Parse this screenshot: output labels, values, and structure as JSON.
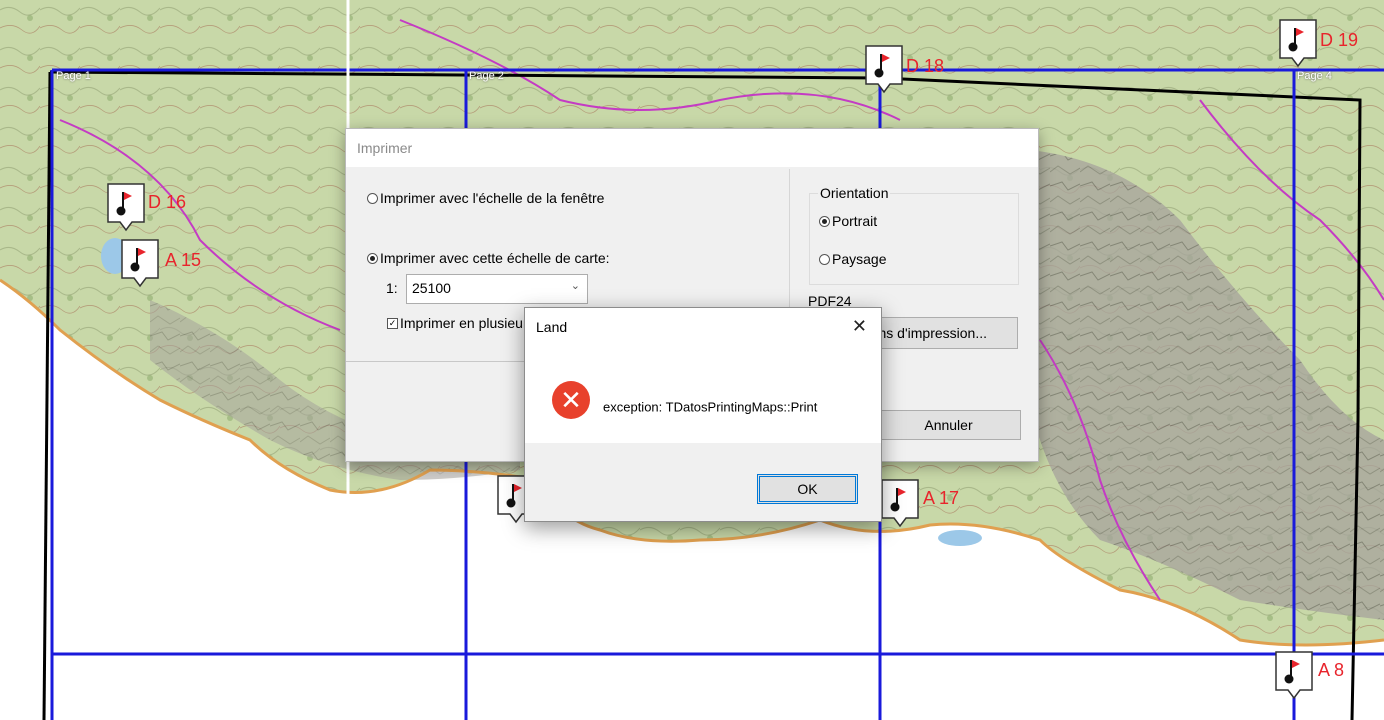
{
  "map": {
    "page_labels": [
      "Page 1",
      "Page 2",
      "Page 4"
    ],
    "waypoints": [
      {
        "label": "D 16"
      },
      {
        "label": "A 15"
      },
      {
        "label": "D 18"
      },
      {
        "label": "D 19"
      },
      {
        "label": "A 17"
      },
      {
        "label": "A 8"
      },
      {
        "label": ""
      }
    ],
    "colors": {
      "page_grid": "#1a1adb",
      "route": "#000000",
      "waypoint_text": "#e8242c",
      "flag": "#e8242c"
    }
  },
  "print_dialog": {
    "title": "Imprimer",
    "option_window_scale": "Imprimer avec l'échelle de la fenêtre",
    "option_map_scale": "Imprimer avec cette échelle de carte:",
    "scale_prefix": "1:",
    "scale_value": "25100",
    "multi_page_checkbox": "Imprimer en plusieurs",
    "orientation": {
      "legend": "Orientation",
      "portrait": "Portrait",
      "landscape": "Paysage",
      "selected": "Portrait"
    },
    "printer_name": "PDF24",
    "options_button": "ns d'impression...",
    "cancel_button": "Annuler"
  },
  "error_dialog": {
    "title": "Land",
    "message": "exception: TDatosPrintingMaps::Print",
    "ok_button": "OK",
    "icon": "error-icon"
  }
}
